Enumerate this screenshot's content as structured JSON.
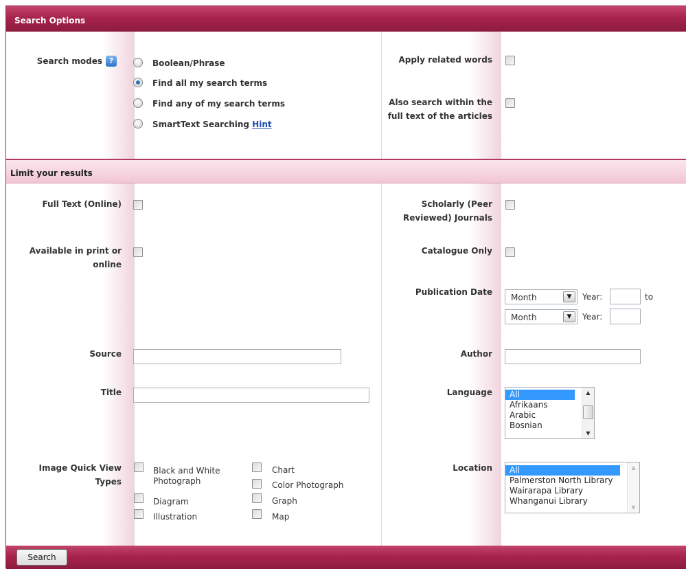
{
  "search_options": {
    "header": "Search Options",
    "search_modes_label": "Search modes",
    "help_icon": "help-question-icon",
    "modes": [
      {
        "label": "Boolean/Phrase",
        "selected": false
      },
      {
        "label": "Find all my search terms",
        "selected": true
      },
      {
        "label": "Find any of my search terms",
        "selected": false
      },
      {
        "label": "SmartText Searching",
        "selected": false
      }
    ],
    "hint_link": "Hint",
    "apply_related_label": "Apply related words",
    "full_text_search_label_line1": "Also search within the",
    "full_text_search_label_line2": "full text of the articles"
  },
  "limit_results": {
    "header": "Limit your results",
    "full_text_label": "Full Text (Online)",
    "scholarly_label_line1": "Scholarly (Peer",
    "scholarly_label_line2": "Reviewed) Journals",
    "available_label_line1": "Available in print or",
    "available_label_line2": "online",
    "catalogue_label": "Catalogue Only",
    "pub_date_label": "Publication Date",
    "pub_date": {
      "from_month": "Month",
      "year_label": "Year:",
      "to_label": "to",
      "to_month": "Month",
      "year_label2": "Year:"
    },
    "source_label": "Source",
    "author_label": "Author",
    "title_label": "Title",
    "language_label": "Language",
    "languages": [
      "All",
      "Afrikaans",
      "Arabic",
      "Bosnian"
    ],
    "image_types_label_line1": "Image Quick View",
    "image_types_label_line2": "Types",
    "image_types": {
      "bw_photo_line1": "Black and White",
      "bw_photo_line2": "Photograph",
      "chart": "Chart",
      "color_photo": "Color Photograph",
      "diagram": "Diagram",
      "graph": "Graph",
      "illustration": "Illustration",
      "map": "Map"
    },
    "location_label": "Location",
    "locations": [
      "All",
      "Palmerston North Library",
      "Wairarapa Library",
      "Whanganui Library"
    ]
  },
  "search_button": "Search",
  "colors": {
    "header": "#a8244d",
    "selected": "#3399ff",
    "link": "#1a4bb5"
  }
}
